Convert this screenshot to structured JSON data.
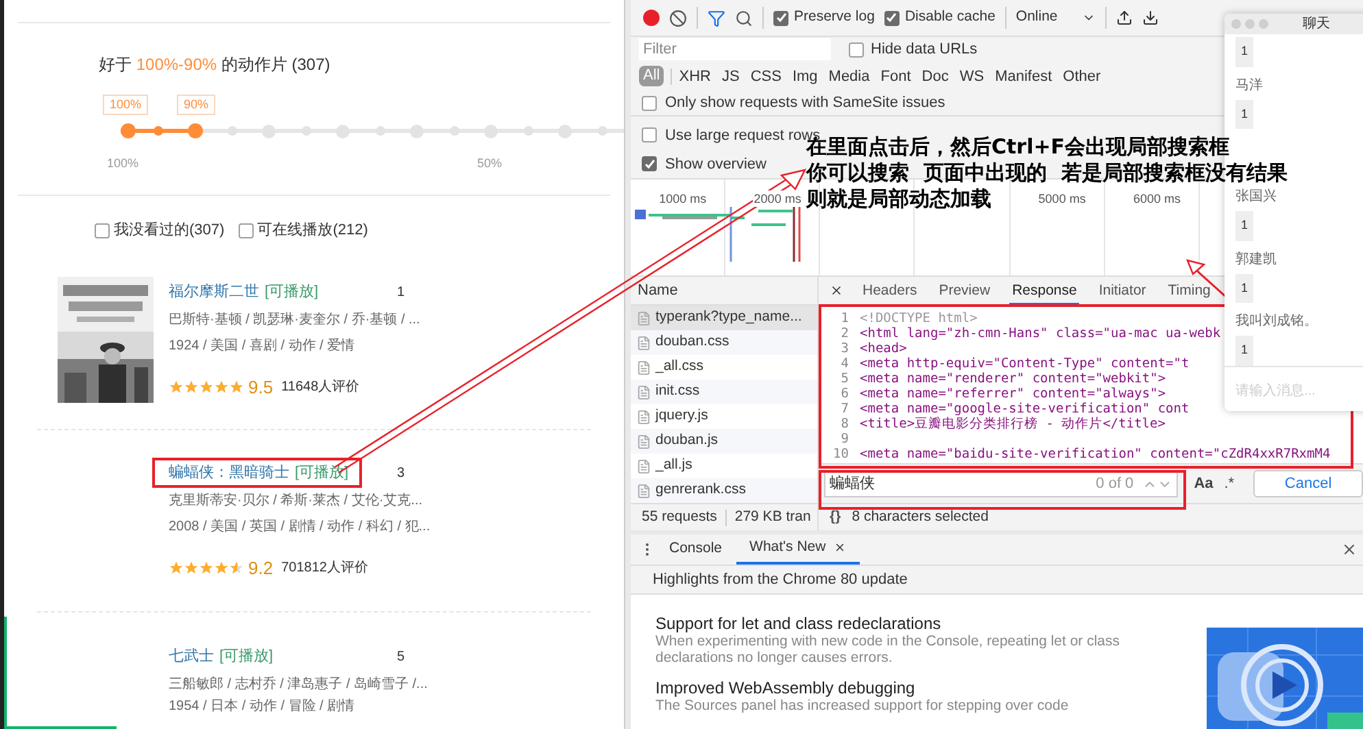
{
  "page": {
    "heading": {
      "prefix": "好于",
      "range": "100%-90%",
      "suffix": "的动作片 (307)"
    },
    "range_slider": {
      "handles": [
        "100%",
        "90%"
      ],
      "level": 0.15,
      "scale": [
        "100%",
        "50%"
      ]
    },
    "filters": [
      {
        "label": "我没看过的(307)",
        "checked": false
      },
      {
        "label": "可在线播放(212)",
        "checked": false
      }
    ],
    "movies": [
      {
        "title": "福尔摩斯二世",
        "tag": "[可播放]",
        "rank": "1",
        "has_poster": true,
        "highlighted": false,
        "cast": "巴斯特·基顿 / 凯瑟琳·麦奎尔 / 乔·基顿 / ...",
        "info": "1924 / 美国 / 喜剧 / 动作 / 爱情",
        "stars": 5,
        "score": "9.5",
        "votes": "11648人评价"
      },
      {
        "title": "蝙蝠侠：黑暗骑士",
        "tag": "[可播放]",
        "rank": "3",
        "has_poster": false,
        "highlighted": true,
        "cast": "克里斯蒂安·贝尔 / 希斯·莱杰 / 艾伦·艾克...",
        "info": "2008 / 美国 / 英国 / 剧情 / 动作 / 科幻 / 犯...",
        "stars": 4.5,
        "score": "9.2",
        "votes": "701812人评价"
      },
      {
        "title": "七武士",
        "tag": "[可播放]",
        "rank": "5",
        "has_poster": false,
        "highlighted": false,
        "cast": "三船敏郎 / 志村乔 / 津岛惠子 / 岛崎雪子 /...",
        "info": "1954 / 日本 / 动作 / 冒险 / 剧情"
      }
    ]
  },
  "devtools": {
    "preserve_log": {
      "label": "Preserve log",
      "checked": true
    },
    "disable_cache": {
      "label": "Disable cache",
      "checked": true
    },
    "throttling": "Online",
    "filter": {
      "placeholder": "Filter"
    },
    "hide_data_urls": {
      "label": "Hide data URLs",
      "checked": false
    },
    "types": [
      {
        "label": "All",
        "selected": true
      },
      {
        "label": "XHR",
        "selected": false
      },
      {
        "label": "JS",
        "selected": false
      },
      {
        "label": "CSS",
        "selected": false
      },
      {
        "label": "Img",
        "selected": false
      },
      {
        "label": "Media",
        "selected": false
      },
      {
        "label": "Font",
        "selected": false
      },
      {
        "label": "Doc",
        "selected": false
      },
      {
        "label": "WS",
        "selected": false
      },
      {
        "label": "Manifest",
        "selected": false
      },
      {
        "label": "Other",
        "selected": false
      }
    ],
    "samesite": {
      "label": "Only show requests with SameSite issues",
      "checked": false
    },
    "options": [
      {
        "label": "Use large request rows",
        "checked": false
      },
      {
        "label": "Show overview",
        "checked": true
      }
    ],
    "overview_ticks": [
      "1000 ms",
      "2000 ms",
      "5000 ms",
      "6000 ms"
    ],
    "name_column": "Name",
    "requests": [
      {
        "name": "typerank?type_name...",
        "selected": true
      },
      {
        "name": "douban.css",
        "selected": false
      },
      {
        "name": "_all.css",
        "selected": false
      },
      {
        "name": "init.css",
        "selected": false
      },
      {
        "name": "jquery.js",
        "selected": false
      },
      {
        "name": "douban.js",
        "selected": false
      },
      {
        "name": "_all.js",
        "selected": false
      },
      {
        "name": "genrerank.css",
        "selected": false
      }
    ],
    "detail_tabs": [
      {
        "label": "Headers",
        "selected": false
      },
      {
        "label": "Preview",
        "selected": false
      },
      {
        "label": "Response",
        "selected": true
      },
      {
        "label": "Initiator",
        "selected": false
      },
      {
        "label": "Timing",
        "selected": false
      }
    ],
    "code": [
      {
        "number": "1",
        "kind": "doctype",
        "text": "<!DOCTYPE html>"
      },
      {
        "number": "2",
        "kind": "code",
        "text": "<html lang=\"zh-cmn-Hans\" class=\"ua-mac ua-webk"
      },
      {
        "number": "3",
        "kind": "code",
        "text": "<head>"
      },
      {
        "number": "4",
        "kind": "code",
        "text": "    <meta http-equiv=\"Content-Type\" content=\"t"
      },
      {
        "number": "5",
        "kind": "code",
        "text": "    <meta name=\"renderer\" content=\"webkit\">"
      },
      {
        "number": "6",
        "kind": "code",
        "text": "    <meta name=\"referrer\" content=\"always\">"
      },
      {
        "number": "7",
        "kind": "code",
        "text": "    <meta name=\"google-site-verification\" cont"
      },
      {
        "number": "8",
        "kind": "code",
        "text": "    <title>豆瓣电影分类排行榜 - 动作片</title>"
      },
      {
        "number": "9",
        "kind": "blank"
      },
      {
        "number": "10",
        "kind": "code",
        "text": "    <meta name=\"baidu-site-verification\" content=\"cZdR4xxR7RxmM4"
      }
    ],
    "search": {
      "value": "蝙蝠侠",
      "count": "0 of 0",
      "case_toggle": "Aa",
      "regex_toggle": ".*",
      "cancel": "Cancel"
    },
    "status": {
      "requests": "55 requests",
      "transferred": "279 KB tran",
      "format": "{}",
      "selection": "8 characters selected"
    },
    "drawer_tabs": [
      {
        "label": "Console",
        "selected": false,
        "closable": false
      },
      {
        "label": "What's New",
        "selected": true,
        "closable": true
      }
    ],
    "highlights": "Highlights from the Chrome 80 update",
    "features": [
      {
        "title": "Support for let and class redeclarations",
        "description": "When experimenting with new code in the Console, repeating let or class declarations no longer causes errors."
      },
      {
        "title": "Improved WebAssembly debugging",
        "description": "The Sources panel has increased support for stepping over code"
      }
    ]
  },
  "chat": {
    "title": "聊天",
    "messages": [
      {
        "text": "1"
      },
      {
        "sender": "马洋",
        "text": "1"
      },
      {
        "sender": "张国兴",
        "text": "1"
      },
      {
        "sender": "郭建凯",
        "text": "1"
      },
      {
        "sender": "我叫刘成铭。",
        "text": "1"
      }
    ],
    "placeholder": "请输入消息..."
  },
  "annotation": {
    "lines": [
      "在里面点击后，然后Ctrl+F会出现局部搜索框",
      "你可以搜索  页面中出现的  若是局部搜索框没有结果",
      "则就是局部动态加载"
    ]
  }
}
